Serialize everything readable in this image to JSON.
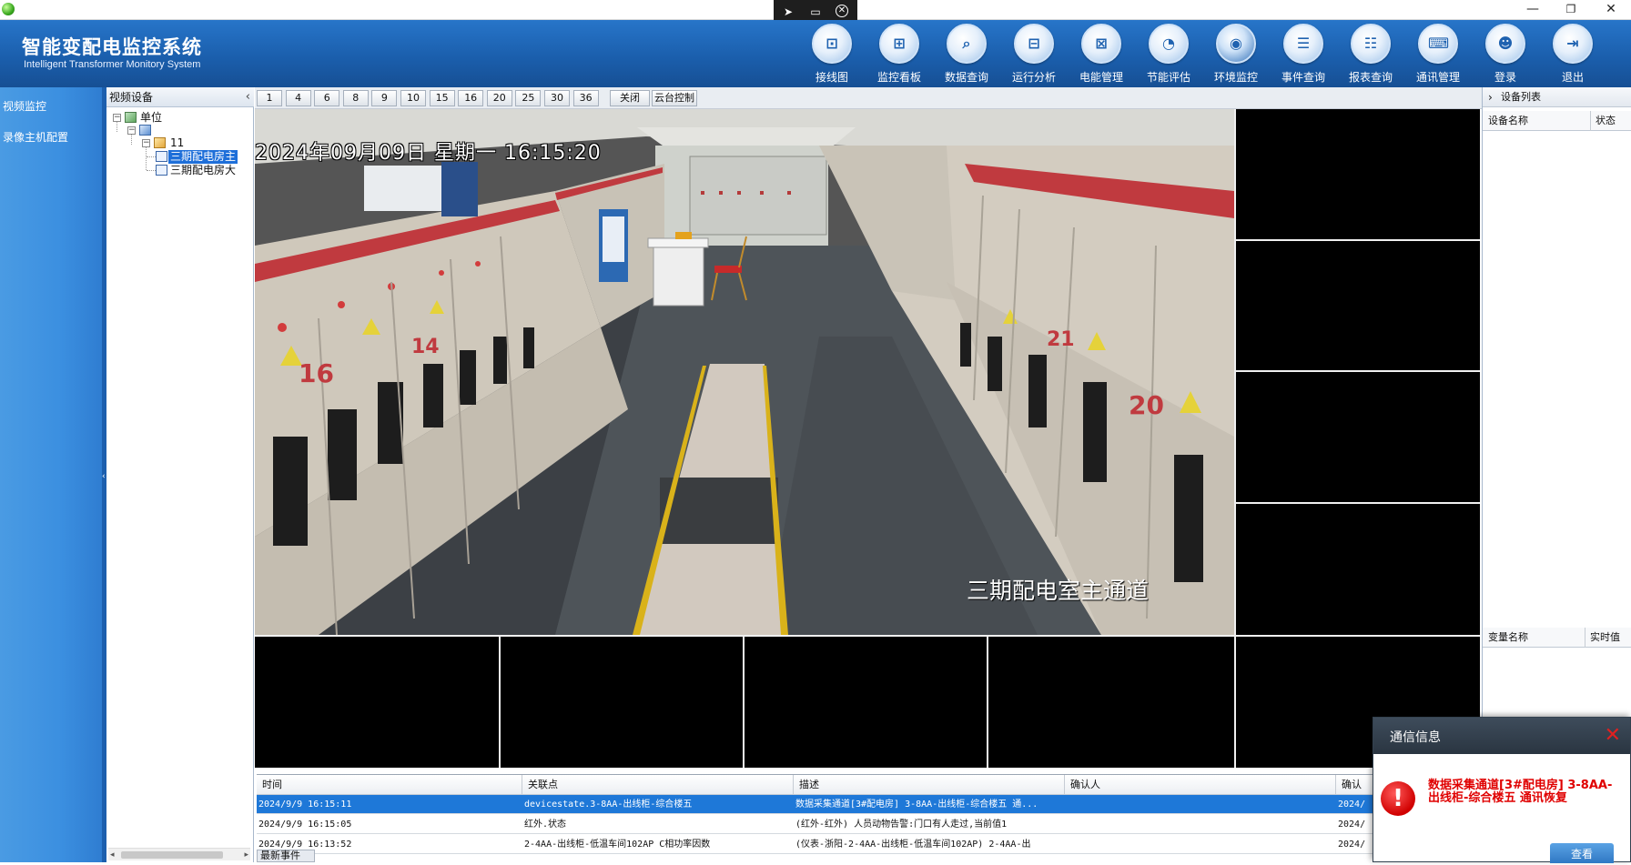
{
  "header": {
    "title_cn": "智能变配电监控系统",
    "title_en": "Intelligent Transformer Monitory System",
    "nav": [
      {
        "label": "接线图",
        "icon": "wiring-diagram-icon",
        "glyph": "⊡"
      },
      {
        "label": "监控看板",
        "icon": "dashboard-icon",
        "glyph": "⊞"
      },
      {
        "label": "数据查询",
        "icon": "satellite-dish-icon",
        "glyph": "⌕"
      },
      {
        "label": "运行分析",
        "icon": "network-icon",
        "glyph": "⊟"
      },
      {
        "label": "电能管理",
        "icon": "power-management-icon",
        "glyph": "⊠"
      },
      {
        "label": "节能评估",
        "icon": "pie-chart-icon",
        "glyph": "◔"
      },
      {
        "label": "环境监控",
        "icon": "camera-icon",
        "glyph": "◉"
      },
      {
        "label": "事件查询",
        "icon": "event-list-icon",
        "glyph": "☰"
      },
      {
        "label": "报表查询",
        "icon": "report-icon",
        "glyph": "☷"
      },
      {
        "label": "通讯管理",
        "icon": "communication-icon",
        "glyph": "⌨"
      },
      {
        "label": "登录",
        "icon": "user-icon",
        "glyph": "☻"
      },
      {
        "label": "退出",
        "icon": "exit-icon",
        "glyph": "⇥"
      }
    ],
    "active_index": 6
  },
  "sidebar": {
    "items": [
      {
        "label": "视频监控"
      },
      {
        "label": "录像主机配置"
      }
    ]
  },
  "tree": {
    "title": "视频设备",
    "root": "单位",
    "group": "11",
    "cameras": [
      {
        "label": "三期配电房主",
        "selected": true
      },
      {
        "label": "三期配电房大",
        "selected": false
      }
    ]
  },
  "toolbar": {
    "layouts": [
      "1",
      "4",
      "6",
      "8",
      "9",
      "10",
      "15",
      "16",
      "20",
      "25",
      "30",
      "36"
    ],
    "close_label": "关闭",
    "ptz_label": "云台控制"
  },
  "camera": {
    "osd_time": "2024年09月09日  星期一  16:15:20",
    "osd_name": "三期配电室主通道"
  },
  "right_panel": {
    "device_list_title": "设备列表",
    "col_name": "设备名称",
    "col_status": "状态",
    "var_name": "变量名称",
    "var_value": "实时值"
  },
  "events": {
    "columns": [
      "时间",
      "关联点",
      "描述",
      "确认人",
      "确认"
    ],
    "rows": [
      {
        "time": "2024/9/9 16:15:11",
        "point": "devicestate.3-8AA-出线柜-综合楼五",
        "desc": "数据采集通道[3#配电房]  3-8AA-出线柜-综合楼五 通...",
        "user": "",
        "confirm": "2024/"
      },
      {
        "time": "2024/9/9 16:15:05",
        "point": "红外.状态",
        "desc": "(红外-红外) 人员动物告警:门口有人走过,当前值1",
        "user": "",
        "confirm": "2024/"
      },
      {
        "time": "2024/9/9 16:13:52",
        "point": "2-4AA-出线柜-低温车间102AP C相功率因数",
        "desc": "(仪表-浙阳-2-4AA-出线柜-低温车间102AP) 2-4AA-出",
        "user": "",
        "confirm": "2024/"
      }
    ],
    "tab_label": "最新事件"
  },
  "notification": {
    "title": "通信信息",
    "message": "数据采集通道[3#配电房] 3-8AA-出线柜-综合楼五 通讯恢复",
    "button": "查看"
  },
  "colors": {
    "header_blue": "#1b5fad",
    "sidebar_blue": "#3b8fe0",
    "selection_blue": "#1e78d8",
    "alert_red": "#e00000"
  }
}
